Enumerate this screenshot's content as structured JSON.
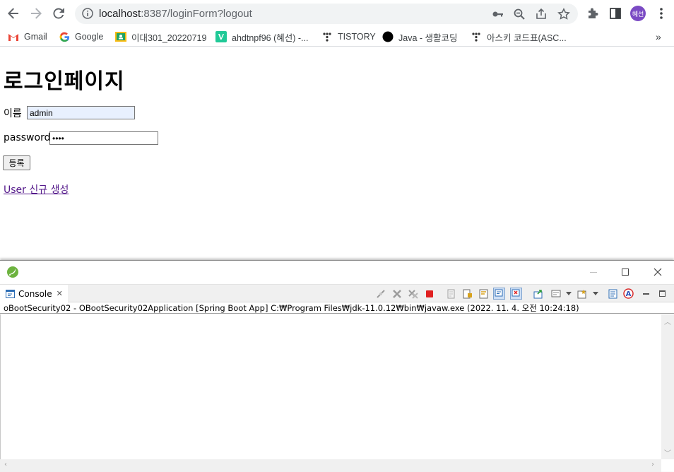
{
  "browser": {
    "url_host": "localhost",
    "url_rest": ":8387/loginForm?logout",
    "avatar_text": "혜선",
    "accent": "#7b4bc4"
  },
  "bookmarks": [
    {
      "label": "Gmail",
      "icon": "gmail-icon"
    },
    {
      "label": "Google",
      "icon": "google-icon"
    },
    {
      "label": "이대301_20220719",
      "icon": "classroom-icon"
    },
    {
      "label": "ahdtnpf96 (혜선) -...",
      "icon": "velog-icon"
    },
    {
      "label": "TISTORY",
      "icon": "tistory-icon"
    },
    {
      "label": "Java - 생활코딩",
      "icon": "opentutorials-icon"
    },
    {
      "label": "아스키 코드표(ASC...",
      "icon": "tistory-icon"
    }
  ],
  "page": {
    "title": "로그인페이지",
    "name_label": "이름",
    "name_value": "admin",
    "password_label": "password",
    "password_value": "••••",
    "submit_label": "등록",
    "signup_link": "User 신규 생성"
  },
  "console": {
    "tab_label": "Console",
    "description": "oBootSecurity02 - OBootSecurity02Application [Spring Boot App] C:₩Program Files₩jdk-11.0.12₩bin₩javaw.exe  (2022. 11. 4. 오전 10:24:18)"
  }
}
